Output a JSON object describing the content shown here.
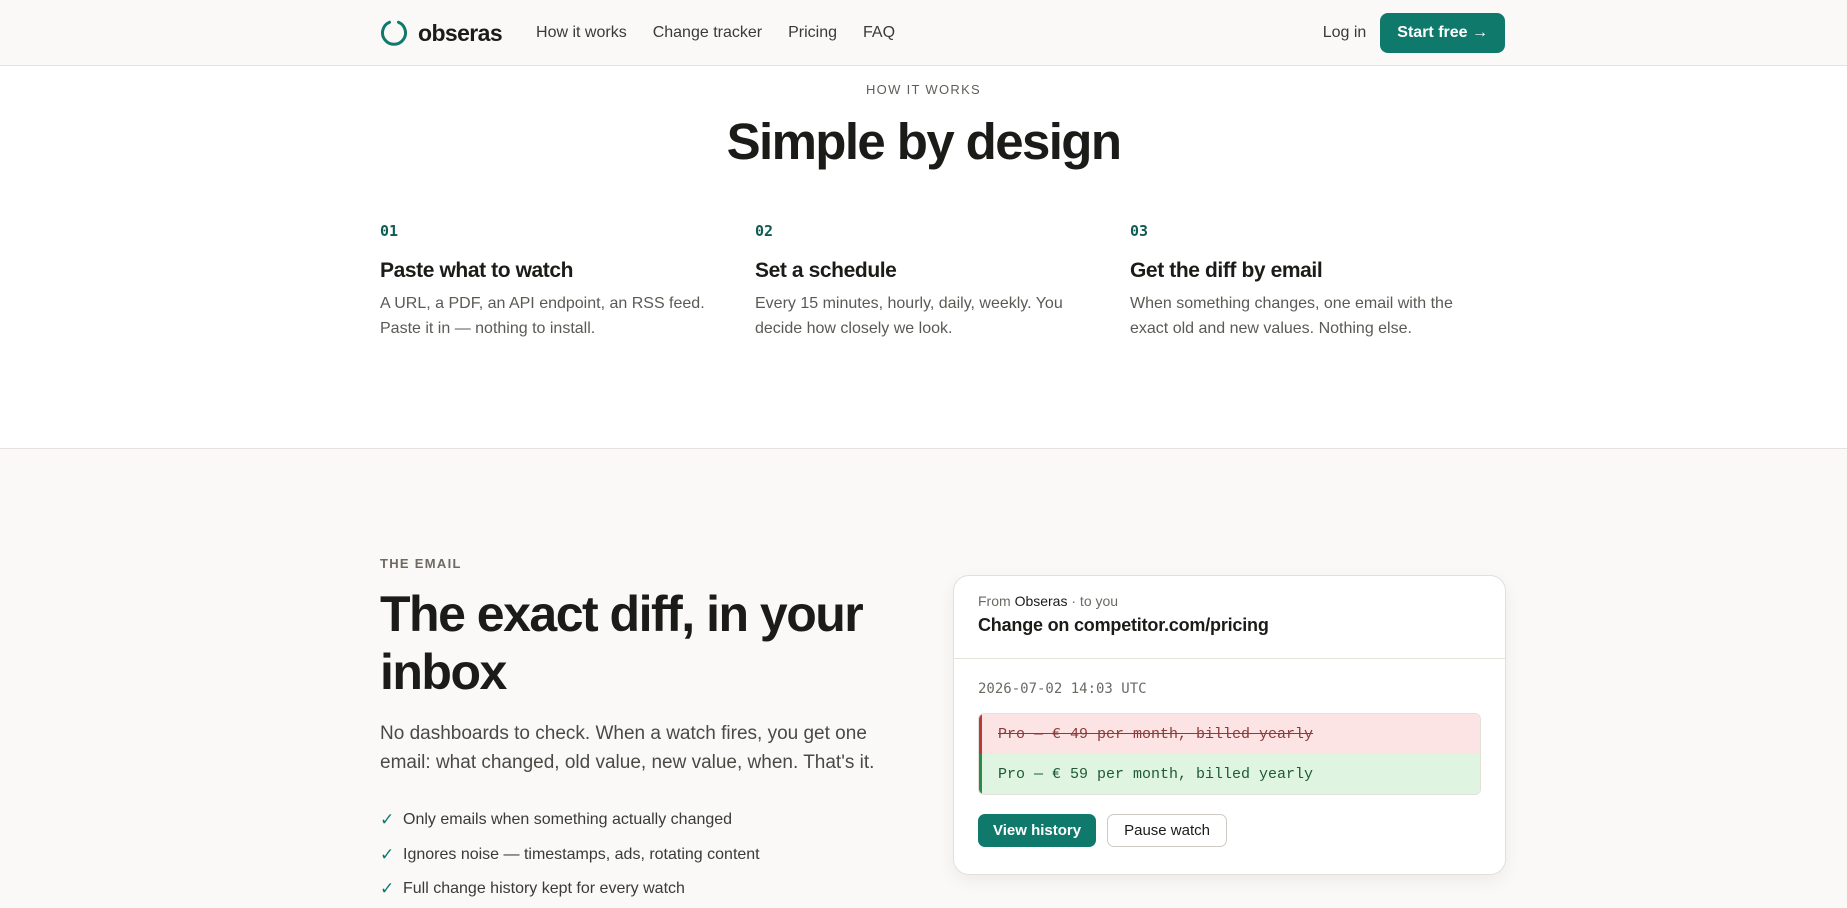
{
  "nav": {
    "logo_text": "obseras",
    "links": [
      "How it works",
      "Change tracker",
      "Pricing",
      "FAQ"
    ],
    "login_label": "Log in",
    "cta_label": "Start free →"
  },
  "how_it_works": {
    "eyebrow": "HOW IT WORKS",
    "title": "Simple by design",
    "steps": [
      {
        "num": "01",
        "title": "Paste what to watch",
        "text": "A URL, a PDF, an API endpoint, an RSS feed. Paste it in — nothing to install."
      },
      {
        "num": "02",
        "title": "Set a schedule",
        "text": "Every 15 minutes, hourly, daily, weekly. You decide how closely we look."
      },
      {
        "num": "03",
        "title": "Get the diff by email",
        "text": "When something changes, one email with the exact old and new values. Nothing else."
      }
    ]
  },
  "email_section": {
    "eyebrow": "THE EMAIL",
    "title": "The exact diff, in your inbox",
    "lead": "No dashboards to check. When a watch fires, you get one email: what changed, old value, new value, when. That's it.",
    "checks": [
      "Only emails when something actually changed",
      "Ignores noise — timestamps, ads, rotating content",
      "Full change history kept for every watch"
    ]
  },
  "email_card": {
    "from_prefix": "From ",
    "sender": "Obseras",
    "from_suffix": " · to you",
    "subject": "Change on competitor.com/pricing",
    "timestamp": "2026-07-02 14:03 UTC",
    "old_value": "Pro — € 49 per month, billed yearly",
    "new_value": "Pro — € 59 per month, billed yearly",
    "primary_action": "View history",
    "secondary_action": "Pause watch"
  },
  "colors": {
    "accent": "#0f7a6c",
    "diff_removed_bg": "#fde4e4",
    "diff_added_bg": "#dff5e1"
  },
  "icons": {
    "logo": "ring-logo-icon",
    "check": "check-icon"
  }
}
